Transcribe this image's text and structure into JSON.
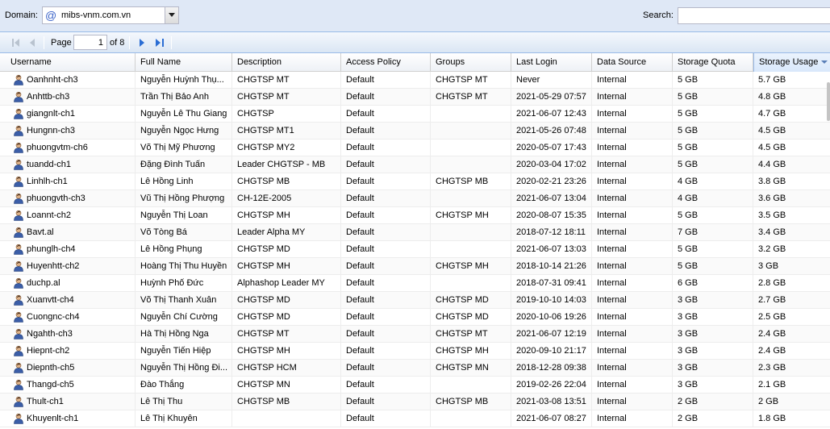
{
  "toolbar": {
    "domain_label": "Domain:",
    "domain_value": "mibs-vnm.com.vn",
    "domain_icon": "at-sign-icon",
    "search_label": "Search:",
    "search_value": ""
  },
  "paging": {
    "page_label": "Page",
    "current_page": "1",
    "of_label": "of 8"
  },
  "columns": [
    "Username",
    "Full Name",
    "Description",
    "Access Policy",
    "Groups",
    "Last Login",
    "Data Source",
    "Storage Quota",
    "Storage Usage"
  ],
  "sorted_column": "Storage Usage",
  "rows": [
    [
      "Oanhnht-ch3",
      "Nguyễn Huỳnh Thụ...",
      "CHGTSP MT",
      "Default",
      "CHGTSP MT",
      "Never",
      "Internal",
      "5 GB",
      "5.7 GB"
    ],
    [
      "Anhttb-ch3",
      "Trần Thị Bảo Anh",
      "CHGTSP MT",
      "Default",
      "CHGTSP MT",
      "2021-05-29 07:57",
      "Internal",
      "5 GB",
      "4.8 GB"
    ],
    [
      "giangnlt-ch1",
      "Nguyễn Lê Thu Giang",
      "CHGTSP",
      "Default",
      "",
      "2021-06-07 12:43",
      "Internal",
      "5 GB",
      "4.7 GB"
    ],
    [
      "Hungnn-ch3",
      "Nguyễn Ngọc Hưng",
      "CHGTSP MT1",
      "Default",
      "",
      "2021-05-26 07:48",
      "Internal",
      "5 GB",
      "4.5 GB"
    ],
    [
      "phuongvtm-ch6",
      "Võ Thị Mỹ Phương",
      "CHGTSP MY2",
      "Default",
      "",
      "2020-05-07 17:43",
      "Internal",
      "5 GB",
      "4.5 GB"
    ],
    [
      "tuandd-ch1",
      "Đặng Đình Tuấn",
      "Leader CHGTSP - MB",
      "Default",
      "",
      "2020-03-04 17:02",
      "Internal",
      "5 GB",
      "4.4 GB"
    ],
    [
      "Linhlh-ch1",
      "Lê Hồng Linh",
      "CHGTSP MB",
      "Default",
      "CHGTSP MB",
      "2020-02-21 23:26",
      "Internal",
      "4 GB",
      "3.8 GB"
    ],
    [
      "phuongvth-ch3",
      "Vũ Thị Hồng Phượng",
      "CH-12E-2005",
      "Default",
      "",
      "2021-06-07 13:04",
      "Internal",
      "4 GB",
      "3.6 GB"
    ],
    [
      "Loannt-ch2",
      "Nguyễn Thị Loan",
      "CHGTSP MH",
      "Default",
      "CHGTSP MH",
      "2020-08-07 15:35",
      "Internal",
      "5 GB",
      "3.5 GB"
    ],
    [
      "Bavt.al",
      "Võ Tòng Bá",
      "Leader Alpha MY",
      "Default",
      "",
      "2018-07-12 18:11",
      "Internal",
      "7 GB",
      "3.4 GB"
    ],
    [
      "phunglh-ch4",
      "Lê Hồng Phụng",
      "CHGTSP MD",
      "Default",
      "",
      "2021-06-07 13:03",
      "Internal",
      "5 GB",
      "3.2 GB"
    ],
    [
      "Huyenhtt-ch2",
      "Hoàng Thị Thu Huyền",
      "CHGTSP MH",
      "Default",
      "CHGTSP MH",
      "2018-10-14 21:26",
      "Internal",
      "5 GB",
      "3 GB"
    ],
    [
      "duchp.al",
      "Huỳnh Phố Đức",
      "Alphashop Leader MY",
      "Default",
      "",
      "2018-07-31 09:41",
      "Internal",
      "6 GB",
      "2.8 GB"
    ],
    [
      "Xuanvtt-ch4",
      "Võ Thị Thanh Xuân",
      "CHGTSP MD",
      "Default",
      "CHGTSP MD",
      "2019-10-10 14:03",
      "Internal",
      "3 GB",
      "2.7 GB"
    ],
    [
      "Cuongnc-ch4",
      "Nguyễn Chí Cường",
      "CHGTSP MD",
      "Default",
      "CHGTSP MD",
      "2020-10-06 19:26",
      "Internal",
      "3 GB",
      "2.5 GB"
    ],
    [
      "Ngahth-ch3",
      "Hà Thị Hồng Nga",
      "CHGTSP MT",
      "Default",
      "CHGTSP MT",
      "2021-06-07 12:19",
      "Internal",
      "3 GB",
      "2.4 GB"
    ],
    [
      "Hiepnt-ch2",
      "Nguyễn Tiến Hiệp",
      "CHGTSP MH",
      "Default",
      "CHGTSP MH",
      "2020-09-10 21:17",
      "Internal",
      "3 GB",
      "2.4 GB"
    ],
    [
      "Diepnth-ch5",
      "Nguyễn Thị Hồng Đi...",
      "CHGTSP HCM",
      "Default",
      "CHGTSP MN",
      "2018-12-28 09:38",
      "Internal",
      "3 GB",
      "2.3 GB"
    ],
    [
      "Thangd-ch5",
      "Đào Thắng",
      "CHGTSP MN",
      "Default",
      "",
      "2019-02-26 22:04",
      "Internal",
      "3 GB",
      "2.1 GB"
    ],
    [
      "Thult-ch1",
      "Lê Thị Thu",
      "CHGTSP MB",
      "Default",
      "CHGTSP MB",
      "2021-03-08 13:51",
      "Internal",
      "2 GB",
      "2 GB"
    ],
    [
      "Khuyenlt-ch1",
      "Lê Thị Khuyên",
      "",
      "Default",
      "",
      "2021-06-07 08:27",
      "Internal",
      "2 GB",
      "1.8 GB"
    ]
  ]
}
